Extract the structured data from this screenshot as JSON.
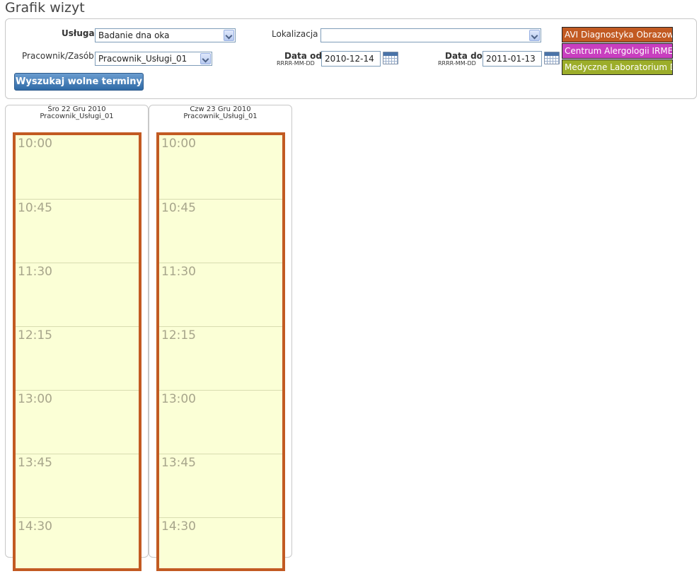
{
  "page": {
    "title": "Grafik wizyt"
  },
  "form": {
    "service_label": "Usługa",
    "service_value": "Badanie dna oka",
    "worker_label": "Pracownik/Zasób",
    "worker_value": "Pracownik_Usługi_01",
    "location_label": "Lokalizacja",
    "location_value": "",
    "date_from_label": "Data od",
    "date_from_format": "RRRR-MM-DD",
    "date_from_value": "2010-12-14",
    "date_to_label": "Data do",
    "date_to_format": "RRRR-MM-DD",
    "date_to_value": "2011-01-13",
    "search_button": "Wyszukaj wolne terminy"
  },
  "legend": [
    {
      "label": "AVI Diagnostyka Obrazowa",
      "color": "#c25a22"
    },
    {
      "label": "Centrum Alergologii IRMED",
      "color": "#c83fbf"
    },
    {
      "label": "Medyczne Laboratorium D",
      "color": "#9cad2a"
    }
  ],
  "days": [
    {
      "date": "Śro 22 Gru 2010",
      "worker": "Pracownik_Usługi_01",
      "slots": [
        "10:00",
        "10:45",
        "11:30",
        "12:15",
        "13:00",
        "13:45",
        "14:30"
      ]
    },
    {
      "date": "Czw 23 Gru 2010",
      "worker": "Pracownik_Usługi_01",
      "slots": [
        "10:00",
        "10:45",
        "11:30",
        "12:15",
        "13:00",
        "13:45",
        "14:30"
      ]
    }
  ],
  "colors": {
    "slot_border": "#c25a22",
    "slot_background": "#fbffd6",
    "button": "#2f6aa6"
  }
}
